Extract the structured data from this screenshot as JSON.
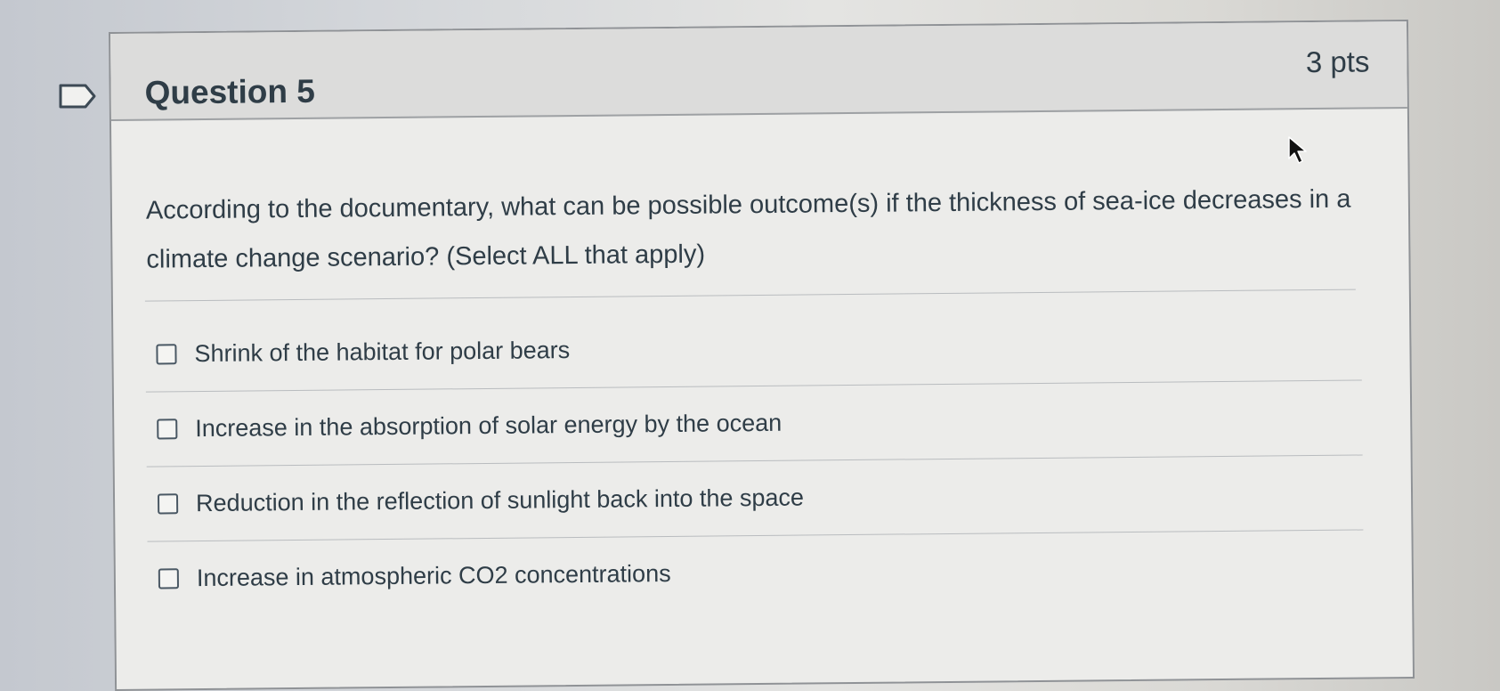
{
  "question": {
    "title": "Question 5",
    "points": "3 pts",
    "text": "According to the documentary, what can be possible outcome(s) if the thickness of sea-ice decreases in a climate change scenario? (Select ALL that apply)"
  },
  "answers": [
    {
      "label": "Shrink of the habitat for polar bears",
      "checked": false
    },
    {
      "label": "Increase in the absorption of solar energy by the ocean",
      "checked": false
    },
    {
      "label": "Reduction in the reflection of sunlight back into the space",
      "checked": false
    },
    {
      "label": "Increase in atmospheric CO2 concentrations",
      "checked": false
    }
  ],
  "icons": {
    "flag": "bookmark-flag-icon",
    "cursor": "mouse-pointer-icon"
  },
  "colors": {
    "text": "#2f3d47",
    "header_bg": "#dcdcdb",
    "card_bg": "#ececea",
    "border": "#8f9296"
  }
}
